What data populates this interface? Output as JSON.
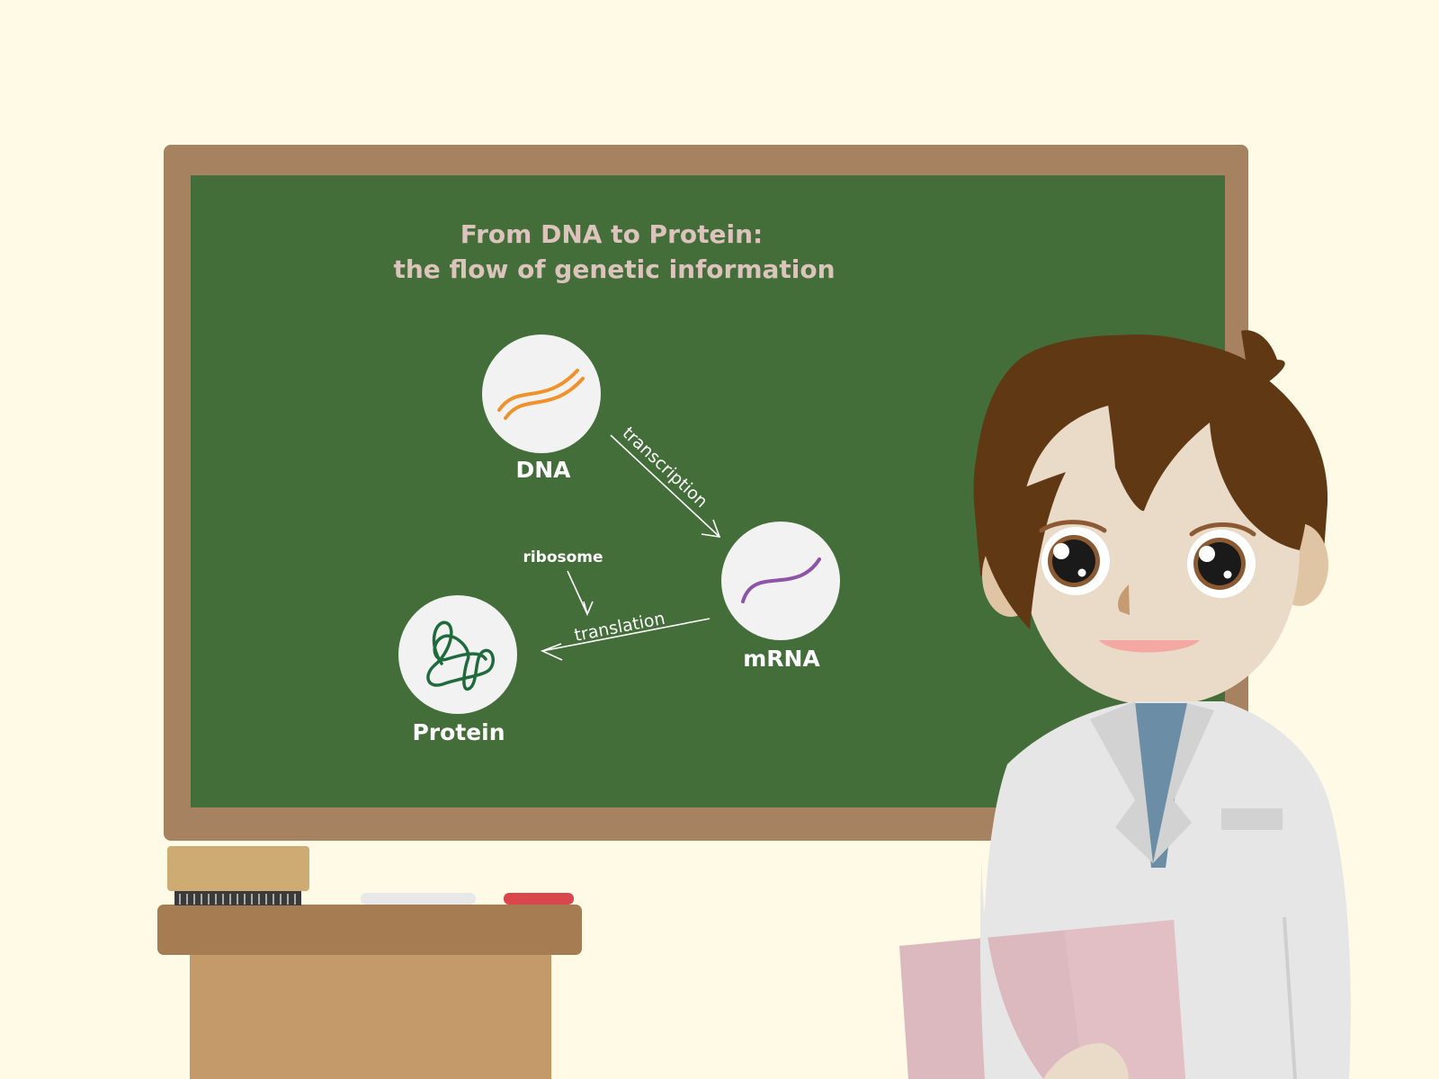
{
  "title": {
    "line1": "From DNA to Protein:",
    "line2": "the flow of genetic information"
  },
  "nodes": {
    "dna": {
      "label": "DNA",
      "icon": "dna-double-strand-icon"
    },
    "mrna": {
      "label": "mRNA",
      "icon": "mrna-strand-icon"
    },
    "protein": {
      "label": "Protein",
      "icon": "protein-coil-icon"
    }
  },
  "arrows": {
    "transcription": "transcription",
    "translation": "translation",
    "ribosome": "ribosome"
  },
  "colors": {
    "background": "#fffae6",
    "chalkboard": "#436e39",
    "frame": "#a68260",
    "title_chalk": "#dcc3bc",
    "dna_strand": "#f0922a",
    "mrna_strand": "#8e54a8",
    "protein_coil": "#1f6b3c",
    "node_fill": "#f2f2f2",
    "hair": "#603914",
    "skin": "#eadac8",
    "lab_coat": "#e6e6e6",
    "folder": "#dcb8bf"
  }
}
